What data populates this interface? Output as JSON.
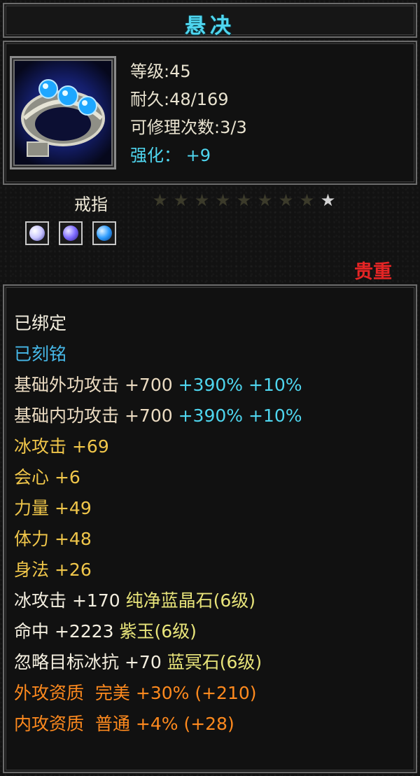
{
  "item": {
    "name": "悬决",
    "level_label": "等级",
    "level": "45",
    "durability_label": "耐久",
    "durability": "48/169",
    "repair_label": "可修理次数",
    "repair": "3/3",
    "enhance_label": "强化：",
    "enhance": "+9",
    "type": "戒指",
    "stars_total": 9,
    "stars_lit": 1,
    "rarity": "贵重",
    "colors": {
      "title": "#4fd6ef",
      "rarity": "#e52525",
      "base_stat": "#ecdcc2",
      "bonus_stat": "#f0c64a",
      "percent": "#4fd6ef",
      "quality": "#ff8a1e"
    }
  },
  "gems": [
    {
      "icon": "white-blue-gem-icon",
      "color": "#c9c6ff"
    },
    {
      "icon": "purple-gem-icon",
      "color": "#7d6bff"
    },
    {
      "icon": "blue-gem-icon",
      "color": "#2d9cff"
    }
  ],
  "status": {
    "bound": "已绑定",
    "engraved": "已刻铭"
  },
  "base_attacks": [
    {
      "label": "基础外功攻击",
      "value": "+700",
      "pct1": "+390%",
      "pct2": "+10%"
    },
    {
      "label": "基础内功攻击",
      "value": "+700",
      "pct1": "+390%",
      "pct2": "+10%"
    }
  ],
  "bonus_stats": [
    {
      "label": "冰攻击",
      "value": "+69"
    },
    {
      "label": "会心",
      "value": "+6"
    },
    {
      "label": "力量",
      "value": "+49"
    },
    {
      "label": "体力",
      "value": "+48"
    },
    {
      "label": "身法",
      "value": "+26"
    }
  ],
  "gem_stats": [
    {
      "label": "冰攻击",
      "value": "+170",
      "gem": "纯净蓝晶石(6级)"
    },
    {
      "label": "命中",
      "value": "+2223",
      "gem": "紫玉(6级)"
    },
    {
      "label": "忽略目标冰抗",
      "value": "+70",
      "gem": "蓝冥石(6级)"
    }
  ],
  "qualities": [
    {
      "label": "外攻资质",
      "grade": "完美",
      "pct": "+30%",
      "bonus": "(+210)"
    },
    {
      "label": "内攻资质",
      "grade": "普通",
      "pct": "+4%",
      "bonus": "(+28)"
    }
  ]
}
